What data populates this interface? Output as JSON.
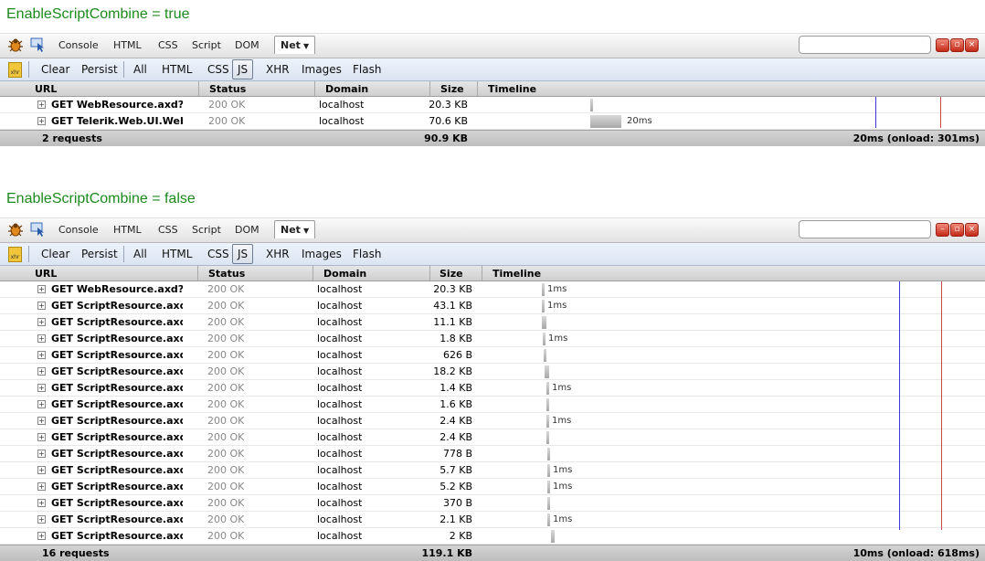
{
  "panels": [
    {
      "heading": "EnableScriptCombine = true",
      "tabs": [
        "Console",
        "HTML",
        "CSS",
        "Script",
        "DOM",
        "Net"
      ],
      "selected_tab": "Net",
      "toolbar": [
        "Clear",
        "Persist",
        "All",
        "HTML",
        "CSS",
        "JS",
        "XHR",
        "Images",
        "Flash"
      ],
      "selected_filter": "JS",
      "xhr_icon_text": "xhr",
      "columns": {
        "url": "URL",
        "status": "Status",
        "domain": "Domain",
        "size": "Size",
        "timeline": "Timeline"
      },
      "rows": [
        {
          "url": "GET WebResource.axd?d=",
          "status": "200 OK",
          "domain": "localhost",
          "size": "20.3 KB",
          "timing": ""
        },
        {
          "url": "GET Telerik.Web.UI.WebR",
          "status": "200 OK",
          "domain": "localhost",
          "size": "70.6 KB",
          "timing": "20ms"
        }
      ],
      "summary": {
        "requests": "2 requests",
        "total_size": "90.9 KB",
        "time": "20ms (onload: 301ms)"
      },
      "colors": {
        "dom_line": "#3a3ad8",
        "load_line": "#c84a4a"
      }
    },
    {
      "heading": "EnableScriptCombine = false",
      "tabs": [
        "Console",
        "HTML",
        "CSS",
        "Script",
        "DOM",
        "Net"
      ],
      "selected_tab": "Net",
      "toolbar": [
        "Clear",
        "Persist",
        "All",
        "HTML",
        "CSS",
        "JS",
        "XHR",
        "Images",
        "Flash"
      ],
      "selected_filter": "JS",
      "xhr_icon_text": "xhr",
      "columns": {
        "url": "URL",
        "status": "Status",
        "domain": "Domain",
        "size": "Size",
        "timeline": "Timeline"
      },
      "rows": [
        {
          "url": "GET WebResource.axd?d=",
          "status": "200 OK",
          "domain": "localhost",
          "size": "20.3 KB",
          "timing": "1ms"
        },
        {
          "url": "GET ScriptResource.axd?c",
          "status": "200 OK",
          "domain": "localhost",
          "size": "43.1 KB",
          "timing": "1ms"
        },
        {
          "url": "GET ScriptResource.axd?c",
          "status": "200 OK",
          "domain": "localhost",
          "size": "11.1 KB",
          "timing": ""
        },
        {
          "url": "GET ScriptResource.axd?c",
          "status": "200 OK",
          "domain": "localhost",
          "size": "1.8 KB",
          "timing": "1ms"
        },
        {
          "url": "GET ScriptResource.axd?c",
          "status": "200 OK",
          "domain": "localhost",
          "size": "626 B",
          "timing": ""
        },
        {
          "url": "GET ScriptResource.axd?c",
          "status": "200 OK",
          "domain": "localhost",
          "size": "18.2 KB",
          "timing": ""
        },
        {
          "url": "GET ScriptResource.axd?c",
          "status": "200 OK",
          "domain": "localhost",
          "size": "1.4 KB",
          "timing": "1ms"
        },
        {
          "url": "GET ScriptResource.axd?c",
          "status": "200 OK",
          "domain": "localhost",
          "size": "1.6 KB",
          "timing": ""
        },
        {
          "url": "GET ScriptResource.axd?c",
          "status": "200 OK",
          "domain": "localhost",
          "size": "2.4 KB",
          "timing": "1ms"
        },
        {
          "url": "GET ScriptResource.axd?c",
          "status": "200 OK",
          "domain": "localhost",
          "size": "2.4 KB",
          "timing": ""
        },
        {
          "url": "GET ScriptResource.axd?c",
          "status": "200 OK",
          "domain": "localhost",
          "size": "778 B",
          "timing": ""
        },
        {
          "url": "GET ScriptResource.axd?c",
          "status": "200 OK",
          "domain": "localhost",
          "size": "5.7 KB",
          "timing": "1ms"
        },
        {
          "url": "GET ScriptResource.axd?c",
          "status": "200 OK",
          "domain": "localhost",
          "size": "5.2 KB",
          "timing": "1ms"
        },
        {
          "url": "GET ScriptResource.axd?c",
          "status": "200 OK",
          "domain": "localhost",
          "size": "370 B",
          "timing": ""
        },
        {
          "url": "GET ScriptResource.axd?c",
          "status": "200 OK",
          "domain": "localhost",
          "size": "2.1 KB",
          "timing": "1ms"
        },
        {
          "url": "GET ScriptResource.axd?c",
          "status": "200 OK",
          "domain": "localhost",
          "size": "2 KB",
          "timing": ""
        }
      ],
      "summary": {
        "requests": "16 requests",
        "total_size": "119.1 KB",
        "time": "10ms (onload: 618ms)"
      },
      "colors": {
        "dom_line": "#3a3ad8",
        "load_line": "#c84a4a"
      }
    }
  ]
}
